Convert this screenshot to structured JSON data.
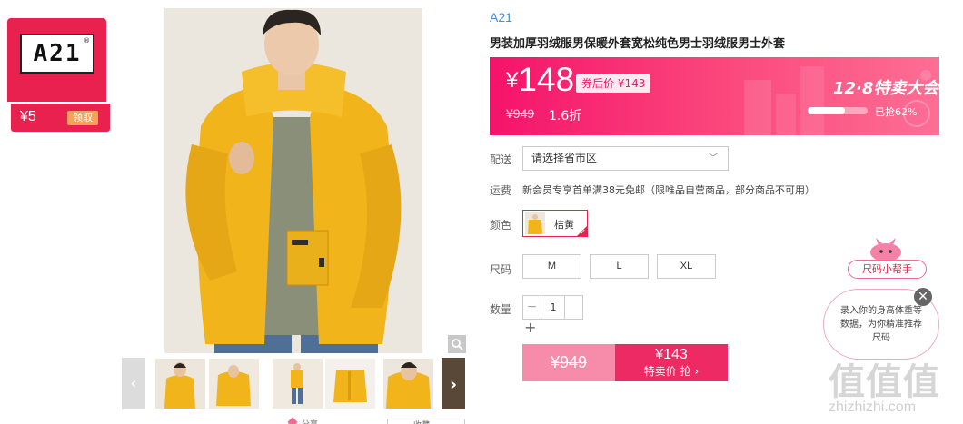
{
  "brand_card": {
    "logo_text": "A21",
    "reg_mark": "®",
    "coupon_amount": "¥5",
    "claim_label": "领取"
  },
  "gallery": {
    "prev_arrow": "‹",
    "next_arrow": "›",
    "zoom_icon": "magnifier-icon"
  },
  "product": {
    "brand": "A21",
    "title": "男装加厚羽绒服男保暖外套宽松纯色男士羽绒服男士外套"
  },
  "price_banner": {
    "currency": "¥",
    "current_price": "148",
    "coupon_price": "券后价 ¥143",
    "original_price": "¥949",
    "discount": "1.6折",
    "event_title": "12·8特卖大会",
    "progress_label": "已抢62%",
    "progress_percent": 62,
    "colors": {
      "primary": "#f5136b",
      "accent": "#fd6e94"
    }
  },
  "delivery": {
    "label": "配送",
    "placeholder": "请选择省市区",
    "chevron": "﹀"
  },
  "shipping": {
    "label": "运费",
    "text": "新会员专享首单满38元免邮（限唯品自营商品，部分商品不可用）"
  },
  "color": {
    "label": "颜色",
    "option": "桔黄",
    "check": "✓"
  },
  "size": {
    "label": "尺码",
    "options": [
      "M",
      "L",
      "XL"
    ]
  },
  "quantity": {
    "label": "数量",
    "minus": "−",
    "value": "1",
    "plus": "+"
  },
  "buy": {
    "original_price": "¥949",
    "special_price": "¥143",
    "special_label": "特卖价 抢 ›"
  },
  "assistant": {
    "title": "尺码小帮手",
    "text": "录入你的身高体重等数据，为你精准推荐尺码",
    "close": "✕"
  },
  "watermark": {
    "big": "值值值",
    "small": "zhizhizhi.com"
  },
  "footer_partial": {
    "left": "分享",
    "right": "收藏"
  }
}
